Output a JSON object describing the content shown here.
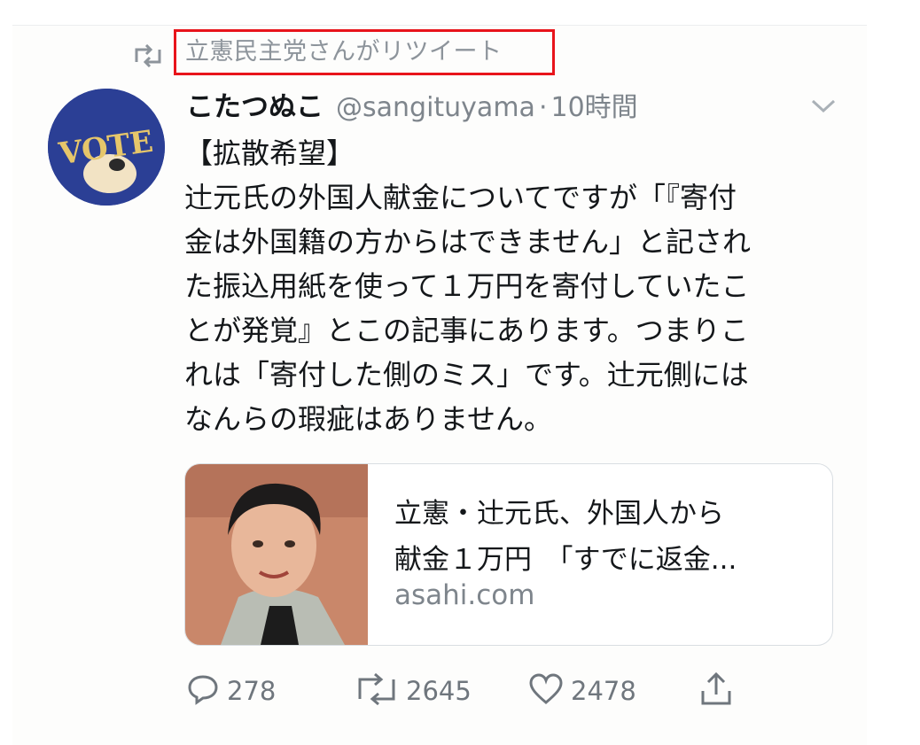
{
  "retweet": {
    "label": "立憲民主党さんがリツイート",
    "icon": "retweet-icon"
  },
  "tweet": {
    "author_name": "こたつぬこ",
    "handle": "@sangituyama",
    "separator": "·",
    "time": "10時間",
    "avatar_text": "VOTE",
    "body_lines": [
      "【拡散希望】",
      "辻元氏の外国人献金についてですが「『寄付",
      "金は外国籍の方からはできません」と記され",
      "た振込用紙を使って１万円を寄付していたこ",
      "とが発覚』とこの記事にあります。つまりこ",
      "れは「寄付した側のミス」です。辻元側には",
      "なんらの瑕疵はありません。"
    ]
  },
  "link_card": {
    "title_lines": [
      "立憲・辻元氏、外国人から",
      "献金１万円　「すでに返金..."
    ],
    "domain": "asahi.com"
  },
  "actions": {
    "replies": "278",
    "retweets": "2645",
    "likes": "2478"
  },
  "colors": {
    "highlight_border": "#e8141b",
    "muted_text": "#7e858c",
    "avatar_bg": "#2b3f95"
  }
}
